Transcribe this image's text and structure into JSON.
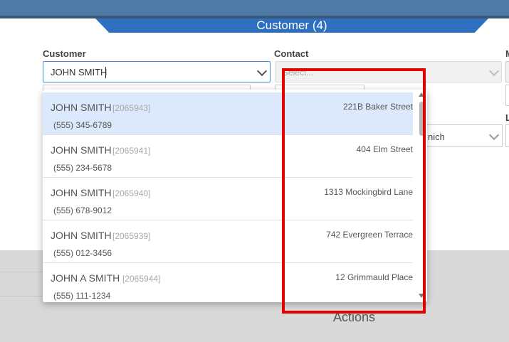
{
  "dialog": {
    "title": "Customer (4)"
  },
  "form": {
    "customer_label": "Customer",
    "customer_value": "JOHN SMITH",
    "contact_label": "Contact",
    "contact_placeholder": "Select...",
    "right_label_1": "M",
    "right_label_2": "L",
    "partial_field_text": "nich"
  },
  "dropdown": {
    "items": [
      {
        "name": "JOHN SMITH",
        "id": "[2065943]",
        "phone": "(555) 345-6789",
        "address": "221B Baker Street"
      },
      {
        "name": "JOHN SMITH",
        "id": "[2065941]",
        "phone": "(555) 234-5678",
        "address": "404 Elm Street"
      },
      {
        "name": "JOHN SMITH",
        "id": "[2065940]",
        "phone": "(555) 678-9012",
        "address": "1313 Mockingbird Lane"
      },
      {
        "name": "JOHN SMITH",
        "id": "[2065939]",
        "phone": "(555) 012-3456",
        "address": "742 Evergreen Terrace"
      },
      {
        "name": "JOHN A SMITH",
        "id": "[2065944]",
        "phone": "(555) 111-1234",
        "address": "12 Grimmauld Place"
      }
    ]
  },
  "background": {
    "actions_label": "Actions"
  },
  "colors": {
    "header_bar": "#4f7aa6",
    "title_tab": "#2f6fc0",
    "selected_row": "#dce8fb",
    "annotation_box": "#e50000"
  }
}
